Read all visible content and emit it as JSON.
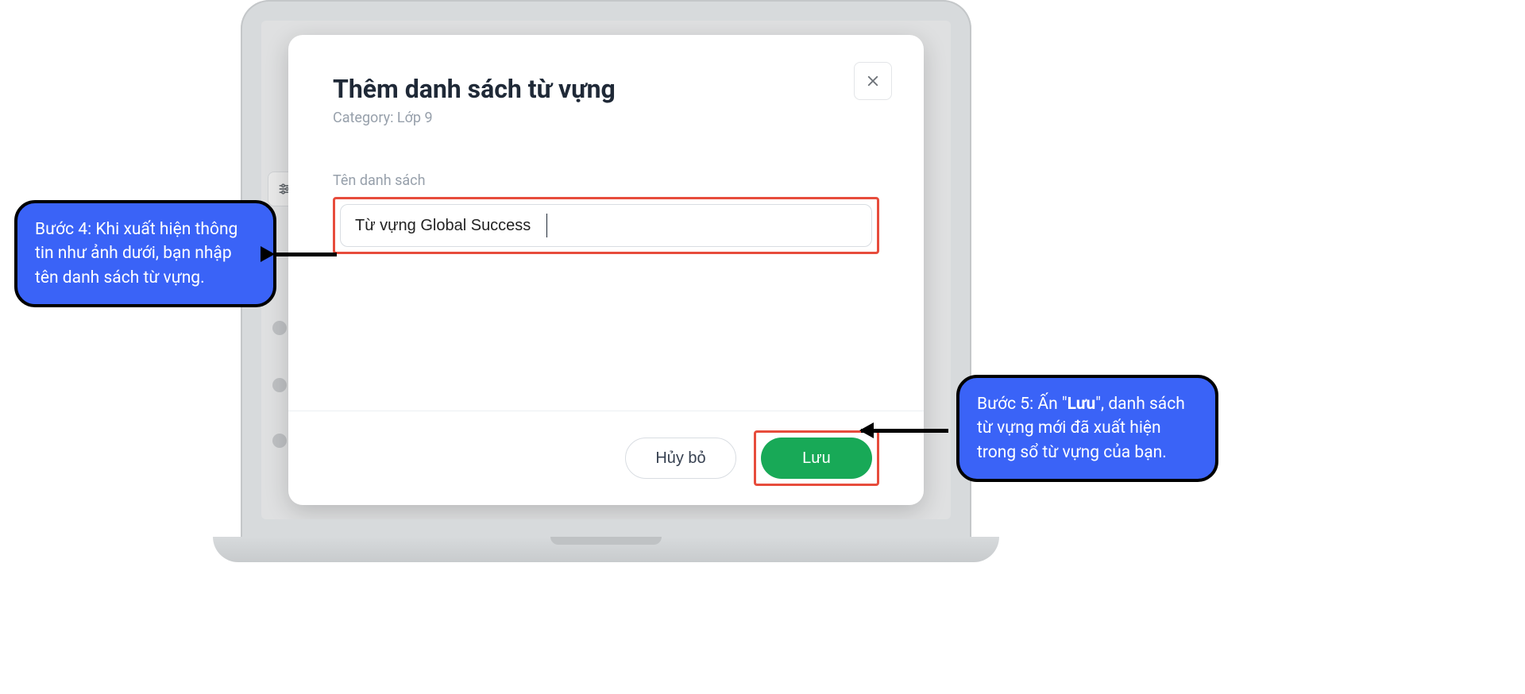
{
  "modal": {
    "title": "Thêm danh sách từ vựng",
    "category_line": "Category: Lớp 9",
    "field_label": "Tên danh sách",
    "field_value": "Từ vựng Global Success",
    "cancel_label": "Hủy bỏ",
    "save_label": "Lưu"
  },
  "callouts": {
    "step4": "Bước 4: Khi xuất hiện thông tin như ảnh dưới, bạn nhập tên danh sách từ vựng.",
    "step5_prefix": "Bước 5: Ấn \"",
    "step5_bold": "Lưu",
    "step5_suffix": "\", danh sách từ vựng mới đã xuất hiện trong sổ từ vựng của bạn."
  }
}
